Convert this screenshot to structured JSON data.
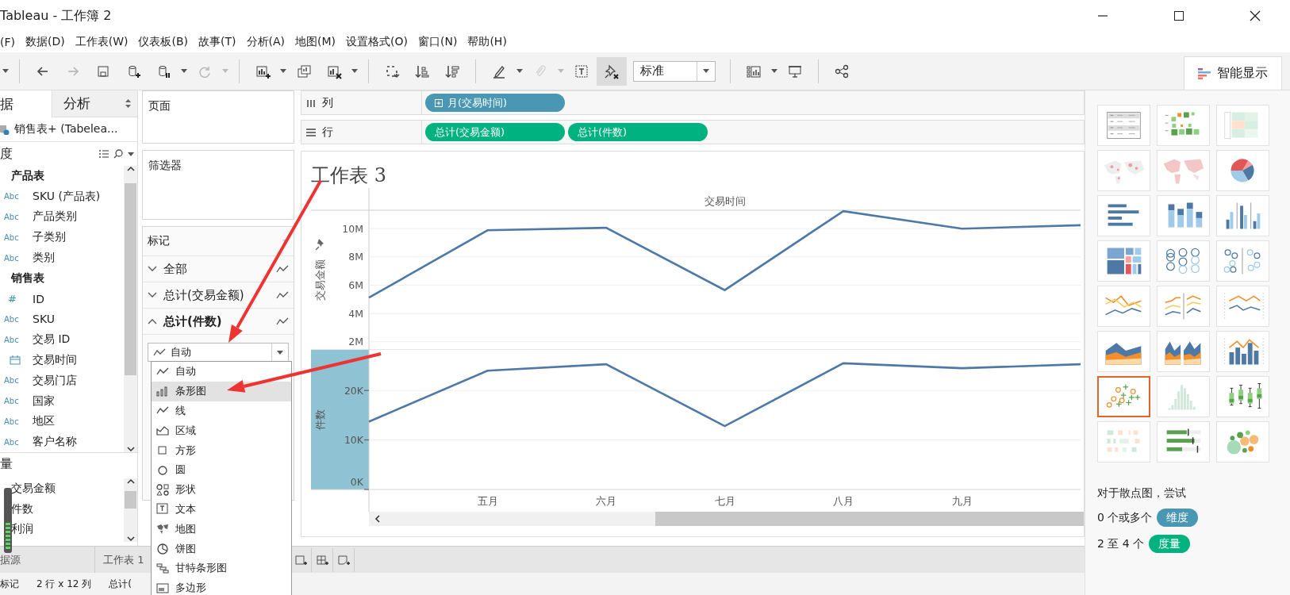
{
  "window": {
    "title": "Tableau - 工作簿 2"
  },
  "menu": [
    "(F)",
    "数据(D)",
    "工作表(W)",
    "仪表板(B)",
    "故事(T)",
    "分析(A)",
    "地图(M)",
    "设置格式(O)",
    "窗口(N)",
    "帮助(H)"
  ],
  "toolbar": {
    "items": [
      {
        "kind": "caret",
        "disabled": false,
        "pressed": false
      },
      {
        "kind": "separator"
      },
      {
        "kind": "back",
        "disabled": false,
        "pressed": false
      },
      {
        "kind": "forward",
        "disabled": true,
        "pressed": false
      },
      {
        "kind": "save",
        "disabled": false,
        "pressed": false
      },
      {
        "kind": "new-datasource",
        "disabled": false,
        "pressed": false
      },
      {
        "kind": "pause",
        "disabled": false,
        "pressed": false
      },
      {
        "kind": "caret",
        "disabled": false,
        "pressed": false
      },
      {
        "kind": "refresh",
        "disabled": true,
        "pressed": false
      },
      {
        "kind": "caret",
        "disabled": true,
        "pressed": false
      },
      {
        "kind": "separator"
      },
      {
        "kind": "new-sheet",
        "disabled": false,
        "pressed": false
      },
      {
        "kind": "caret",
        "disabled": false,
        "pressed": false
      },
      {
        "kind": "duplicate",
        "disabled": false,
        "pressed": false
      },
      {
        "kind": "clear",
        "disabled": false,
        "pressed": false
      },
      {
        "kind": "caret",
        "disabled": false,
        "pressed": false
      },
      {
        "kind": "separator"
      },
      {
        "kind": "swap",
        "disabled": false,
        "pressed": false
      },
      {
        "kind": "sort-asc",
        "disabled": false,
        "pressed": false
      },
      {
        "kind": "sort-desc",
        "disabled": false,
        "pressed": false
      },
      {
        "kind": "separator"
      },
      {
        "kind": "highlight",
        "disabled": false,
        "pressed": false
      },
      {
        "kind": "caret",
        "disabled": false,
        "pressed": false
      },
      {
        "kind": "attach",
        "disabled": true,
        "pressed": false
      },
      {
        "kind": "caret",
        "disabled": true,
        "pressed": false
      },
      {
        "kind": "label",
        "disabled": false,
        "pressed": false
      },
      {
        "kind": "pin",
        "disabled": false,
        "pressed": true
      },
      {
        "kind": "select",
        "value": "标准"
      },
      {
        "kind": "separator"
      },
      {
        "kind": "cards",
        "disabled": false,
        "pressed": false
      },
      {
        "kind": "caret",
        "disabled": false,
        "pressed": false
      },
      {
        "kind": "present",
        "disabled": false,
        "pressed": false
      },
      {
        "kind": "separator"
      },
      {
        "kind": "share",
        "disabled": false,
        "pressed": false
      }
    ],
    "show_me_tab": {
      "label": "智能显示",
      "selected": true
    }
  },
  "data_pane": {
    "tabs": [
      {
        "label": "据",
        "selected": true
      },
      {
        "label": "分析",
        "selected": false
      }
    ],
    "datasource": "销售表+ (Tabelea...",
    "dimensions": {
      "header": "度",
      "tables": [
        {
          "name": "产品表",
          "children": [
            {
              "kind": "string",
              "icon": "Abc",
              "name": "SKU (产品表)"
            },
            {
              "kind": "string",
              "icon": "Abc",
              "name": "产品类别"
            },
            {
              "kind": "string",
              "icon": "Abc",
              "name": "子类别"
            },
            {
              "kind": "string",
              "icon": "Abc",
              "name": "类别"
            }
          ]
        },
        {
          "name": "销售表",
          "children": [
            {
              "kind": "number",
              "icon": "#",
              "name": "ID"
            },
            {
              "kind": "string",
              "icon": "Abc",
              "name": "SKU"
            },
            {
              "kind": "string",
              "icon": "Abc",
              "name": "交易 ID"
            },
            {
              "kind": "date",
              "name": "交易时间"
            },
            {
              "kind": "string",
              "icon": "Abc",
              "name": "交易门店"
            },
            {
              "kind": "string",
              "icon": "Abc",
              "name": "国家"
            },
            {
              "kind": "string",
              "icon": "Abc",
              "name": "地区"
            },
            {
              "kind": "string",
              "icon": "Abc",
              "name": "客户名称"
            }
          ]
        }
      ]
    },
    "measures": {
      "header": "量",
      "fields": [
        "交易金额",
        "件数",
        "利润"
      ]
    }
  },
  "shelves": {
    "pages": {
      "title": "页面"
    },
    "filters": {
      "title": "筛选器"
    },
    "marks": {
      "title": "标记",
      "cards": [
        {
          "label": "全部",
          "expanded": false
        },
        {
          "label": "总计(交易金额)",
          "expanded": false
        },
        {
          "label": "总计(件数)",
          "expanded": true
        }
      ],
      "mark_type": "自动"
    }
  },
  "mark_menu": [
    {
      "kind": "auto",
      "label": "自动",
      "selected": false
    },
    {
      "kind": "bar",
      "label": "条形图",
      "selected": true
    },
    {
      "kind": "line",
      "label": "线",
      "selected": false
    },
    {
      "kind": "area",
      "label": "区域",
      "selected": false
    },
    {
      "kind": "square",
      "label": "方形",
      "selected": false
    },
    {
      "kind": "circle",
      "label": "圆",
      "selected": false
    },
    {
      "kind": "shape",
      "label": "形状",
      "selected": false
    },
    {
      "kind": "text",
      "label": "文本",
      "selected": false
    },
    {
      "kind": "map",
      "label": "地图",
      "selected": false
    },
    {
      "kind": "pie",
      "label": "饼图",
      "selected": false
    },
    {
      "kind": "gantt",
      "label": "甘特条形图",
      "selected": false
    },
    {
      "kind": "polygon",
      "label": "多边形",
      "selected": false
    }
  ],
  "columns_shelf": {
    "label": "列",
    "pills": [
      {
        "kind": "dimension",
        "label": "月(交易时间)"
      }
    ]
  },
  "rows_shelf": {
    "label": "行",
    "pills": [
      {
        "kind": "measure",
        "label": "总计(交易金额)"
      },
      {
        "kind": "measure",
        "label": "总计(件数)"
      }
    ]
  },
  "sheet": {
    "title": "工作表 3",
    "panes": [
      {
        "chart_data": {
          "type": "line",
          "xlabel": "交易时间",
          "ylabel": "交易金额",
          "categories": [
            null,
            null,
            null,
            null,
            null,
            null,
            null
          ],
          "grid": true,
          "ylim": [
            1.43,
            11.3
          ],
          "yticks": [
            {
              "value": 2,
              "label": "2M"
            },
            {
              "value": 4,
              "label": "4M"
            },
            {
              "value": 6,
              "label": "6M"
            },
            {
              "value": 8,
              "label": "8M"
            },
            {
              "value": 10,
              "label": "10M"
            }
          ],
          "series": [
            {
              "color": "#4e79a7",
              "values": [
                5.12,
                9.88,
                10.06,
                5.65,
                11.24,
                10.0,
                10.24
              ]
            }
          ]
        }
      },
      {
        "chart_data": {
          "type": "line",
          "ylabel": "件数",
          "categories": [
            null,
            "五月",
            "六月",
            "七月",
            "八月",
            "九月",
            null
          ],
          "grid": true,
          "ylim": [
            0,
            28.2
          ],
          "yticks": [
            {
              "value": 0,
              "label": "0K"
            },
            {
              "value": 10,
              "label": "10K"
            },
            {
              "value": 20,
              "label": "20K"
            }
          ],
          "series": [
            {
              "color": "#4e79a7",
              "values": [
                13.7,
                24.0,
                25.3,
                12.8,
                25.5,
                24.5,
                25.3
              ]
            }
          ]
        }
      }
    ]
  },
  "sheet_tabs": [
    {
      "kind": "datasource",
      "label": "据源"
    },
    {
      "kind": "sheet",
      "label": "工作表 1"
    }
  ],
  "status_bar": [
    "标记",
    "2 行 x 12 列",
    "总计("
  ],
  "show_me": {
    "charts": [
      {
        "kind": "text-table",
        "selected": false
      },
      {
        "kind": "heat-map",
        "selected": false
      },
      {
        "kind": "highlight-table",
        "selected": false
      },
      {
        "kind": "symbol-map",
        "selected": false
      },
      {
        "kind": "filled-map",
        "selected": false
      },
      {
        "kind": "pie-chart",
        "selected": false
      },
      {
        "kind": "horizontal-bar",
        "selected": false
      },
      {
        "kind": "stacked-bar",
        "selected": false
      },
      {
        "kind": "side-by-side-bar",
        "selected": false
      },
      {
        "kind": "treemap",
        "selected": false
      },
      {
        "kind": "circle-view",
        "selected": false
      },
      {
        "kind": "side-by-side-circle",
        "selected": false
      },
      {
        "kind": "continuous-line",
        "selected": false
      },
      {
        "kind": "discrete-line",
        "selected": false
      },
      {
        "kind": "dual-line",
        "selected": false
      },
      {
        "kind": "continuous-area",
        "selected": false
      },
      {
        "kind": "discrete-area",
        "selected": false
      },
      {
        "kind": "dual-combination",
        "selected": false
      },
      {
        "kind": "scatter-plot",
        "selected": true
      },
      {
        "kind": "histogram",
        "selected": false
      },
      {
        "kind": "box-plot",
        "selected": false
      },
      {
        "kind": "gantt-chart",
        "selected": false
      },
      {
        "kind": "bullet-graph",
        "selected": false
      },
      {
        "kind": "packed-bubbles",
        "selected": false
      }
    ],
    "hint": "对于散点图，尝试",
    "requirements": [
      {
        "prefix": "0 个或多个",
        "pill": {
          "kind": "dimension",
          "label": "维度"
        }
      },
      {
        "prefix": "2 至 4 个",
        "pill": {
          "kind": "measure",
          "label": "度量"
        }
      }
    ]
  }
}
